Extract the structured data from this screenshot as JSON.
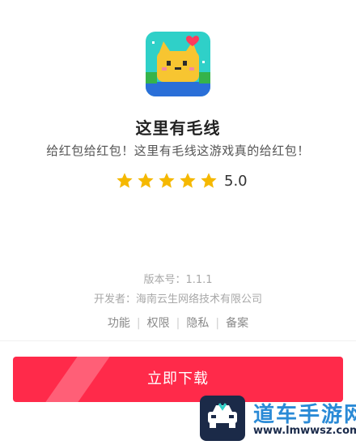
{
  "app": {
    "name": "这里有毛线",
    "tagline": "给红包给红包！这里有毛线这游戏真的给红包！",
    "rating": "5.0",
    "rating_stars": 5,
    "version": "版本号：1.1.1",
    "developer": "开发者：海南云生网络技术有限公司"
  },
  "links": [
    "功能",
    "权限",
    "隐私",
    "备案"
  ],
  "download_label": "立即下载",
  "watermark": {
    "title": "道车手游网",
    "url": "www.lmwwsz.com"
  },
  "colors": {
    "accent": "#ff2a4a",
    "star": "#f5b800",
    "watermark_blue": "#2a8ad6"
  }
}
